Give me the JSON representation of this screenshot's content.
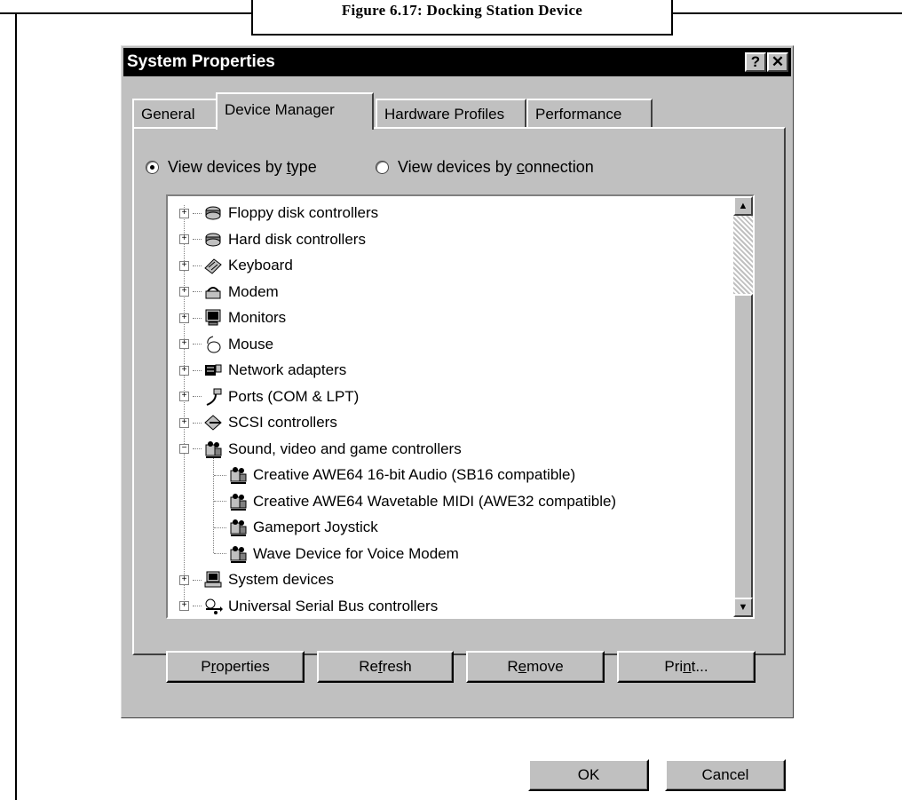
{
  "caption": "Figure 6.17: Docking Station Device",
  "dialog": {
    "title": "System Properties",
    "help_label": "?",
    "close_label": "✕"
  },
  "tabs": [
    {
      "label": "General"
    },
    {
      "label": "Device Manager"
    },
    {
      "label": "Hardware Profiles"
    },
    {
      "label": "Performance"
    }
  ],
  "view": {
    "by_type_prefix": "View devices by ",
    "by_type_key": "t",
    "by_type_suffix": "ype",
    "by_conn_prefix": "View devices by ",
    "by_conn_key": "c",
    "by_conn_suffix": "onnection",
    "selected": "type"
  },
  "devices": [
    {
      "label": "Floppy disk controllers",
      "icon": "floppy-controller-icon"
    },
    {
      "label": "Hard disk controllers",
      "icon": "disk-controller-icon"
    },
    {
      "label": "Keyboard",
      "icon": "keyboard-icon"
    },
    {
      "label": "Modem",
      "icon": "modem-icon"
    },
    {
      "label": "Monitors",
      "icon": "monitor-icon"
    },
    {
      "label": "Mouse",
      "icon": "mouse-icon"
    },
    {
      "label": "Network adapters",
      "icon": "network-adapter-icon"
    },
    {
      "label": "Ports (COM & LPT)",
      "icon": "port-icon"
    },
    {
      "label": "SCSI controllers",
      "icon": "scsi-icon"
    },
    {
      "label": "Sound, video and game controllers",
      "icon": "sound-device-icon"
    },
    {
      "label": "Creative AWE64 16-bit Audio (SB16 compatible)",
      "icon": "sound-device-icon"
    },
    {
      "label": "Creative AWE64 Wavetable MIDI (AWE32 compatible)",
      "icon": "sound-device-icon"
    },
    {
      "label": "Gameport Joystick",
      "icon": "sound-device-icon"
    },
    {
      "label": "Wave Device for Voice Modem",
      "icon": "sound-device-icon"
    },
    {
      "label": "System devices",
      "icon": "computer-icon"
    },
    {
      "label": "Universal Serial Bus controllers",
      "icon": "usb-icon"
    }
  ],
  "buttons": {
    "properties_pre": "P",
    "properties_key": "r",
    "properties_post": "operties",
    "refresh_pre": "Re",
    "refresh_key": "f",
    "refresh_post": "resh",
    "remove_pre": "R",
    "remove_key": "e",
    "remove_post": "move",
    "print_pre": "Pri",
    "print_key": "n",
    "print_post": "t...",
    "ok": "OK",
    "cancel": "Cancel"
  }
}
